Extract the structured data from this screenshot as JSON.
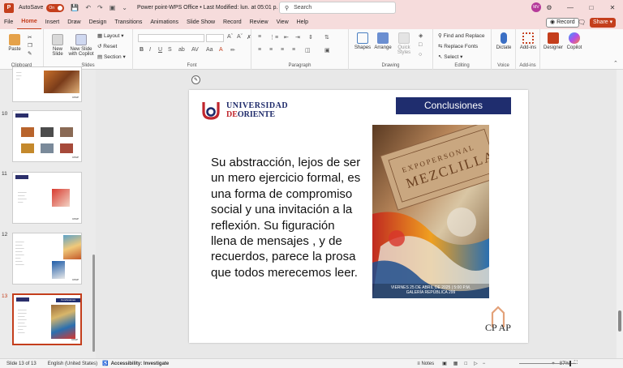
{
  "titlebar": {
    "autosave_label": "AutoSave",
    "autosave_state": "On",
    "doc_title": "Power point-WPS Office • Last Modified: lun. at 05:01 p. m.",
    "search_placeholder": "Search",
    "avatar_initials": "MV"
  },
  "menu": {
    "items": [
      "File",
      "Home",
      "Insert",
      "Draw",
      "Design",
      "Transitions",
      "Animations",
      "Slide Show",
      "Record",
      "Review",
      "View",
      "Help"
    ],
    "active": "Home",
    "record_label": "Record",
    "share_label": "Share"
  },
  "ribbon": {
    "clipboard": {
      "paste": "Paste",
      "label": "Clipboard"
    },
    "slides": {
      "new_slide": "New Slide",
      "new_slide_copilot": "New Slide with Copilot",
      "layout": "Layout",
      "reset": "Reset",
      "section": "Section",
      "label": "Slides"
    },
    "font": {
      "label": "Font"
    },
    "paragraph": {
      "label": "Paragraph"
    },
    "drawing": {
      "shapes": "Shapes",
      "arrange": "Arrange",
      "quick_styles": "Quick Styles",
      "label": "Drawing"
    },
    "editing": {
      "find_replace": "Find and Replace",
      "replace_fonts": "Replace Fonts",
      "select": "Select",
      "label": "Editing"
    },
    "voice": {
      "dictate": "Dictate",
      "label": "Voice"
    },
    "addins": {
      "addins": "Add-ins",
      "label": "Add-ins"
    },
    "designer": "Designer",
    "copilot": "Copilot"
  },
  "thumbnails": [
    {
      "num": "10"
    },
    {
      "num": "11"
    },
    {
      "num": "12"
    },
    {
      "num": "13",
      "title": "Conclusiones"
    }
  ],
  "slide": {
    "uni_line1": "UNIVERSIDAD",
    "uni_line2_prefix": "DE",
    "uni_line2": "ORIENTE",
    "title": "Conclusiones",
    "body": "Su abstracción, lejos de ser un mero ejercicio formal, es una forma de compromiso social y una invitación a la reflexión. Su figuración llena de mensajes , y de recuerdos, parece la prosa que todos merecemos leer.",
    "poster_footer_1": "VIERNES 25 DE ABRIL DE 2025 | 5:00 P.M.",
    "poster_footer_2": "GALERÍA REPÚBLICA 299",
    "cpap": "CP AP"
  },
  "status": {
    "slide_count": "Slide 13 of 13",
    "language": "English (United States)",
    "accessibility": "Accessibility: Investigate",
    "notes": "Notes",
    "zoom": "87%"
  },
  "colors": {
    "accent": "#c43e1c",
    "title_box": "#1f2d6e",
    "uni_blue": "#1e2a6a",
    "uni_red": "#c0262d"
  }
}
